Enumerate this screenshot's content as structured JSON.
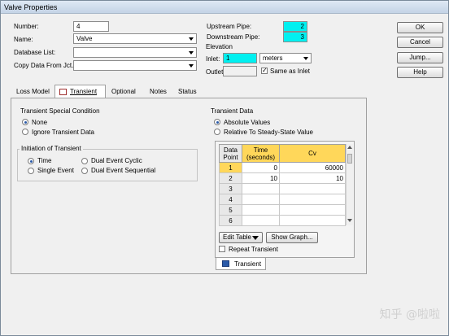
{
  "window": {
    "title": "Valve Properties"
  },
  "form": {
    "number_label": "Number:",
    "number_value": "4",
    "name_label": "Name:",
    "name_value": "Valve",
    "database_label": "Database List:",
    "database_value": "",
    "copy_label": "Copy Data From Jct...",
    "copy_value": ""
  },
  "pipes": {
    "upstream_label": "Upstream Pipe:",
    "upstream_value": "2",
    "downstream_label": "Downstream Pipe:",
    "downstream_value": "3"
  },
  "elevation": {
    "group_label": "Elevation",
    "inlet_label": "Inlet:",
    "inlet_value": "1",
    "unit_value": "meters",
    "outlet_label": "Outlet:",
    "outlet_value": "",
    "same_label": "Same as Inlet"
  },
  "buttons": {
    "ok": "OK",
    "cancel": "Cancel",
    "jump": "Jump...",
    "help": "Help"
  },
  "tabs": [
    {
      "label": "Loss Model"
    },
    {
      "label": "Transient"
    },
    {
      "label": "Optional"
    },
    {
      "label": "Notes"
    },
    {
      "label": "Status"
    }
  ],
  "special": {
    "group_label": "Transient Special Condition",
    "options": [
      "None",
      "Ignore Transient Data"
    ]
  },
  "initiation": {
    "group_label": "Initiation of Transient",
    "options": [
      "Time",
      "Single Event",
      "Dual Event Cyclic",
      "Dual Event Sequential"
    ]
  },
  "transient_data": {
    "group_label": "Transient Data",
    "options": [
      "Absolute Values",
      "Relative To Steady-State Value"
    ],
    "headers": [
      "Data Point",
      "Time (seconds)",
      "Cv"
    ],
    "rows": [
      {
        "point": "1",
        "time": "0",
        "cv": "60000"
      },
      {
        "point": "2",
        "time": "10",
        "cv": "10"
      },
      {
        "point": "3",
        "time": "",
        "cv": ""
      },
      {
        "point": "4",
        "time": "",
        "cv": ""
      },
      {
        "point": "5",
        "time": "",
        "cv": ""
      },
      {
        "point": "6",
        "time": "",
        "cv": ""
      }
    ],
    "edit_table": "Edit Table",
    "show_graph": "Show Graph...",
    "repeat_label": "Repeat Transient",
    "sub_tab": "Transient"
  },
  "watermark": "知乎 @啦啦"
}
